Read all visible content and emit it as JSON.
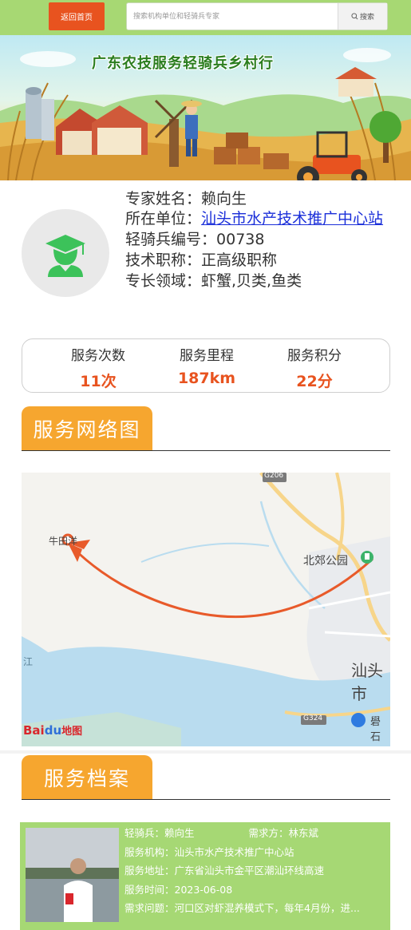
{
  "topbar": {
    "home_label": "返回首页",
    "search_placeholder": "搜索机构单位和轻骑兵专家",
    "search_button": "搜索"
  },
  "banner": {
    "title": "广东农技服务轻骑兵乡村行"
  },
  "expert": {
    "name_label": "专家姓名：",
    "name": "赖向生",
    "org_label": "所在单位：",
    "org": "汕头市水产技术推广中心站",
    "id_label": "轻骑兵编号：",
    "id": "00738",
    "title_label": "技术职称：",
    "title": "正高级职称",
    "specialty_label": "专长领域：",
    "specialty": "虾蟹,贝类,鱼类"
  },
  "stats": [
    {
      "label": "服务次数",
      "value": "11次"
    },
    {
      "label": "服务里程",
      "value": "187km"
    },
    {
      "label": "服务积分",
      "value": "22分"
    }
  ],
  "sections": {
    "network": "服务网络图",
    "archive": "服务档案"
  },
  "map": {
    "labels": {
      "origin": "牛田洋",
      "destination": "北郊公园",
      "city": "汕头市",
      "road_g206": "G206",
      "road_g324": "G324",
      "poi_right": "礐石",
      "river": "江"
    },
    "logo_bai": "Bai",
    "logo_du": "du",
    "logo_map": "地图",
    "colors": {
      "route": "#e85a2a",
      "water": "#b9dcef",
      "road": "#f7d58a"
    }
  },
  "record": {
    "expert_label": "轻骑兵：",
    "expert": "赖向生",
    "requester_label": "需求方：",
    "requester": "林东斌",
    "org_label": "服务机构：",
    "org": "汕头市水产技术推广中心站",
    "address_label": "服务地址：",
    "address": "广东省汕头市金平区潮汕环线高速",
    "time_label": "服务时间：",
    "time": "2023-06-08",
    "issue_label": "需求问题：",
    "issue": "河口区对虾混养模式下，每年4月份，进..."
  },
  "colors": {
    "accent": "#e8531f",
    "topbar": "#a7d873",
    "section_tab": "#f6a62f",
    "card": "#a6d874"
  }
}
